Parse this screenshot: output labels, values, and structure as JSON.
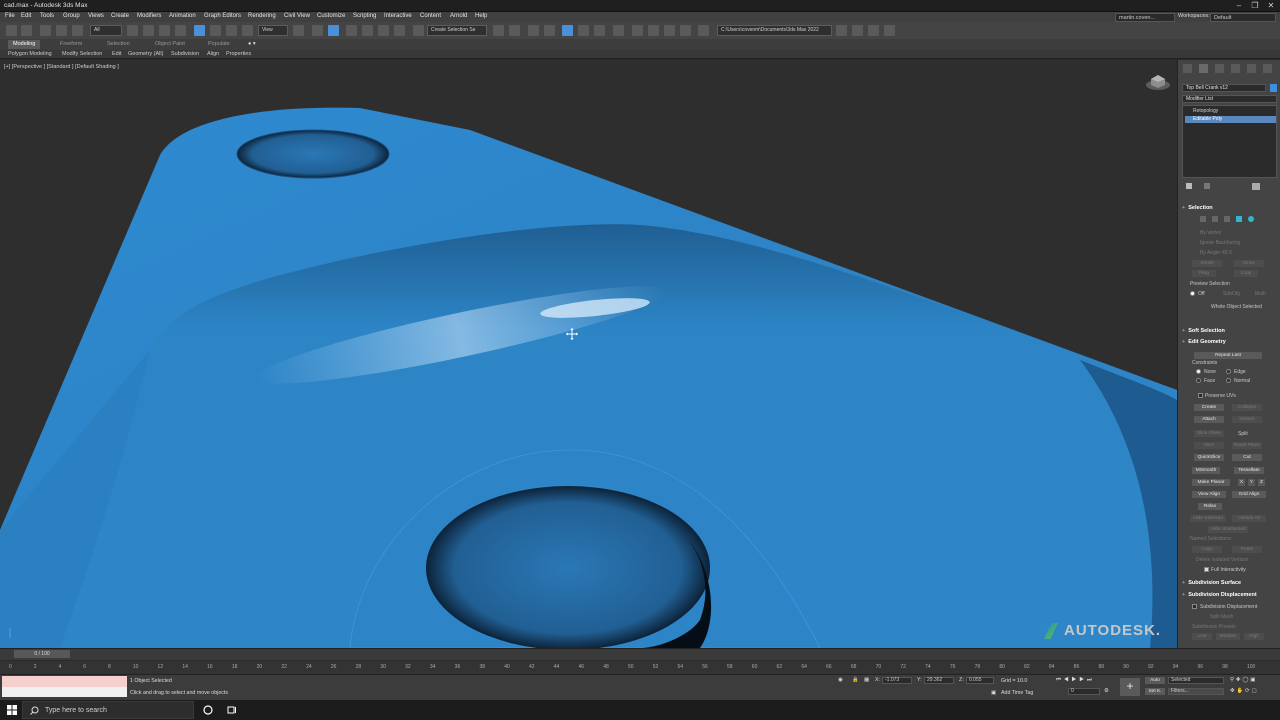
{
  "window": {
    "title": "cad.max - Autodesk 3ds Max"
  },
  "menu": {
    "items": [
      "File",
      "Edit",
      "Tools",
      "Group",
      "Views",
      "Create",
      "Modifiers",
      "Animation",
      "Graph Editors",
      "Rendering",
      "Civil View",
      "Customize",
      "Scripting",
      "Interactive",
      "Content",
      "Arnold",
      "Help"
    ],
    "user": "martin.coven...",
    "workspaces_label": "Workspaces:",
    "workspace_value": "Default"
  },
  "toolbar": {
    "filter_value": "All",
    "view_value": "View",
    "selection_set_placeholder": "Create Selection Se",
    "project_path": "C:\\Users\\covenm\\Documents\\3ds Max 2022"
  },
  "ribbon": {
    "tabs": [
      "Modeling",
      "Freeform",
      "Selection",
      "Object Paint",
      "Populate"
    ],
    "active_tab": "Modeling",
    "subtabs": [
      "Polygon Modeling",
      "Modify Selection",
      "Edit",
      "Geometry (All)",
      "Subdivision",
      "Align",
      "Properties"
    ]
  },
  "viewport": {
    "label": "[+] [Perspective ] [Standard ] [Default Shading ]",
    "watermark": "AUTODESK.",
    "colors": {
      "mesh": "#2f86c9",
      "background": "#2e2e2e"
    }
  },
  "command_panel": {
    "object_name": "Top Bell Crank v12",
    "modifier_list": "Modifier List",
    "stack": [
      {
        "label": "Retopology",
        "selected": false
      },
      {
        "label": "Editable Poly",
        "selected": true
      }
    ],
    "selection": {
      "title": "Selection",
      "by_vertex": "By Vertex",
      "ignore_backfacing": "Ignore Backfacing",
      "by_angle": "By Angle:",
      "by_angle_value": "45.0",
      "shrink": "Shrink",
      "grow": "Grow",
      "ring": "Ring",
      "loop": "Loop",
      "preview_selection": "Preview Selection",
      "preview_options": [
        "Off",
        "SubObj",
        "Multi"
      ],
      "status": "Whole Object Selected"
    },
    "soft_selection": "Soft Selection",
    "edit_geometry": {
      "title": "Edit Geometry",
      "repeat_last": "Repeat Last",
      "constraints": "Constraints",
      "constraint_opts": [
        "None",
        "Edge",
        "Face",
        "Normal"
      ],
      "preserve_uvs": "Preserve UVs",
      "create": "Create",
      "collapse": "Collapse",
      "attach": "Attach",
      "detach": "Detach",
      "slice_plane": "Slice Plane",
      "split": "Split",
      "slice": "Slice",
      "reset_plane": "Reset Plane",
      "quickslice": "QuickSlice",
      "cut": "Cut",
      "msmooth": "MSmooth",
      "tessellate": "Tessellate",
      "make_planar": "Make Planar",
      "x": "X",
      "y": "Y",
      "z": "Z",
      "view_align": "View Align",
      "grid_align": "Grid Align",
      "relax": "Relax",
      "hide_selected": "Hide Selected",
      "unhide_all": "Unhide All",
      "hide_unselected": "Hide Unselected",
      "named_selections": "Named Selections:",
      "copy": "Copy",
      "paste": "Paste",
      "delete_isolated": "Delete Isolated Vertices",
      "full_interactivity": "Full Interactivity"
    },
    "subdivision_surface": "Subdivision Surface",
    "subdivision_displacement": {
      "title": "Subdivision Displacement",
      "check": "Subdivision Displacement",
      "split_mesh": "Split Mesh",
      "presets": "Subdivision Presets",
      "preset_btns": [
        "Low",
        "Medium",
        "High"
      ]
    }
  },
  "timeline": {
    "slider": "0 / 100",
    "ticks": [
      "0",
      "2",
      "4",
      "6",
      "8",
      "10",
      "12",
      "14",
      "16",
      "18",
      "20",
      "22",
      "24",
      "26",
      "28",
      "30",
      "32",
      "34",
      "36",
      "38",
      "40",
      "42",
      "44",
      "46",
      "48",
      "50",
      "52",
      "54",
      "56",
      "58",
      "60",
      "62",
      "64",
      "66",
      "68",
      "70",
      "72",
      "74",
      "76",
      "78",
      "80",
      "82",
      "84",
      "86",
      "88",
      "90",
      "92",
      "94",
      "96",
      "98",
      "100"
    ]
  },
  "status": {
    "objects_selected": "1 Object Selected",
    "prompt": "Click and drag to select and move objects",
    "x_label": "X:",
    "x_value": "-1.073",
    "y_label": "Y:",
    "y_value": "29.362",
    "z_label": "Z:",
    "z_value": "0.055",
    "grid": "Grid = 10.0",
    "add_time_tag": "Add Time Tag",
    "frame": "0",
    "auto": "Auto",
    "set_k": "Set K.",
    "key_mode": "Selected",
    "filters": "Filters..."
  },
  "taskbar": {
    "search_placeholder": "Type here to search"
  }
}
